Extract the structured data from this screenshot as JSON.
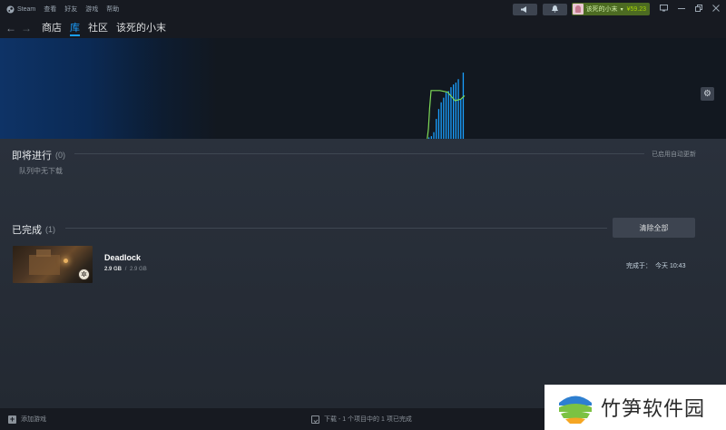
{
  "menubar": {
    "app_name": "Steam",
    "items": [
      "查看",
      "好友",
      "游戏",
      "帮助"
    ],
    "username": "该死的小末",
    "balance": "¥59.23",
    "icons": {
      "announce": "megaphone-icon",
      "notify": "bell-icon",
      "screen": "screen-icon",
      "minimize": "minimize-icon",
      "restore": "restore-icon",
      "close": "close-icon"
    }
  },
  "nav": {
    "links": [
      "商店",
      "库",
      "社区",
      "该死的小末"
    ],
    "active": "库"
  },
  "graph": {
    "colors": {
      "line": "#7ed957",
      "bars": "#1a9fff"
    },
    "bar_heights": [
      0.02,
      0.04,
      0.1,
      0.3,
      0.45,
      0.55,
      0.62,
      0.7,
      0.72,
      0.78,
      0.82,
      0.85,
      0.9,
      0.6,
      1.0
    ],
    "line_points": [
      [
        0.02,
        0.0
      ],
      [
        0.05,
        0.2
      ],
      [
        0.08,
        0.6
      ],
      [
        0.12,
        0.95
      ],
      [
        0.35,
        0.95
      ],
      [
        0.55,
        0.92
      ],
      [
        0.75,
        0.75
      ],
      [
        0.9,
        0.78
      ],
      [
        1.0,
        0.85
      ]
    ]
  },
  "queue": {
    "title": "即将进行",
    "count": "(0)",
    "auto_update": "已启用自动更新",
    "empty_text": "队列中无下载"
  },
  "completed": {
    "title": "已完成",
    "count": "(1)",
    "clear_all": "清除全部",
    "items": [
      {
        "name": "Deadlock",
        "downloaded": "2.9 GB",
        "separator": "/",
        "total": "2.9 GB",
        "completed_label": "完成于：",
        "completed_time": "今天 10:43"
      }
    ]
  },
  "footer": {
    "add_game": "添加游戏",
    "download_status": "下载 - 1 个项目中的 1 项已完成"
  },
  "watermark": {
    "text": "竹笋软件园",
    "colors": {
      "blue": "#2e7fd0",
      "green": "#7cc242",
      "orange": "#f5a623"
    }
  }
}
